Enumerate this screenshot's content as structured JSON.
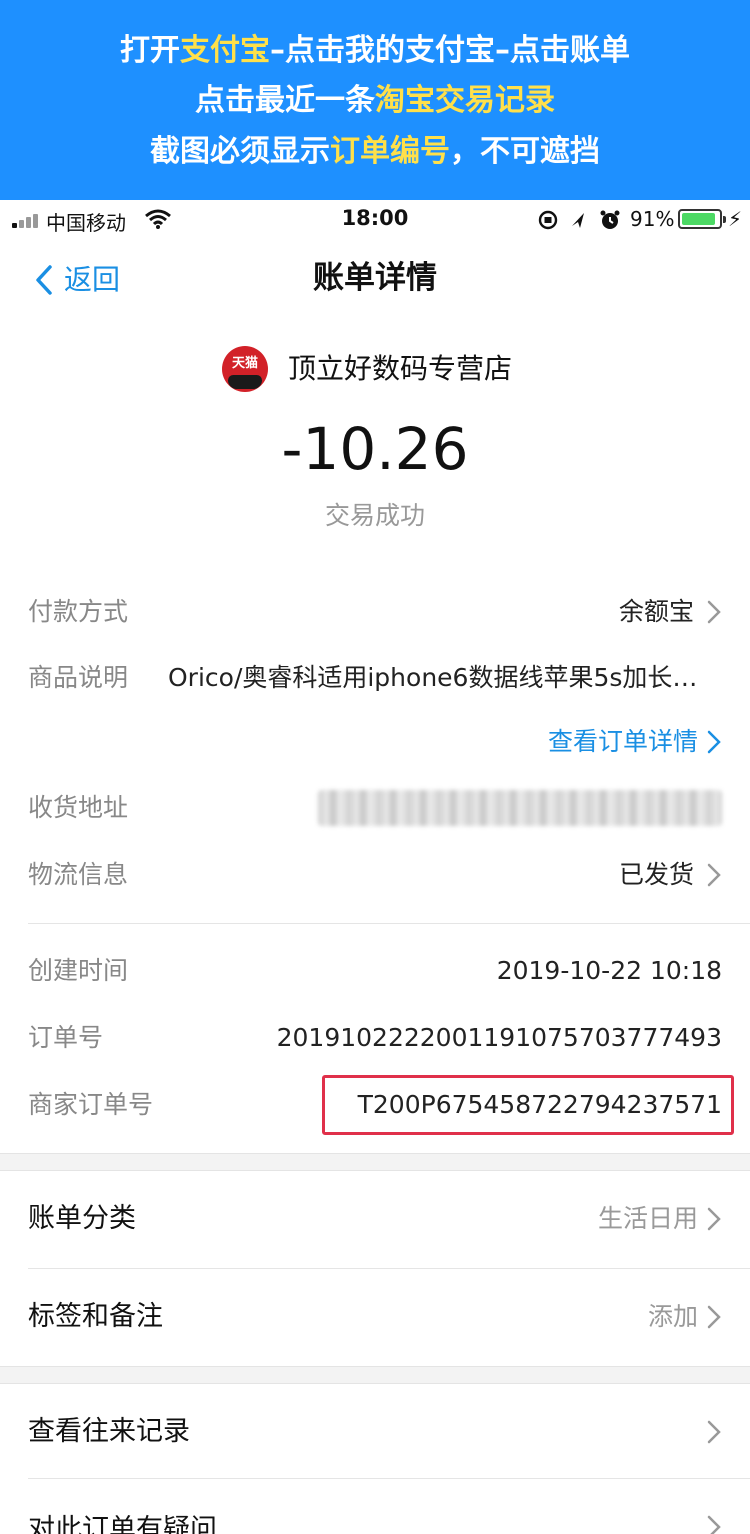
{
  "banner": {
    "line1": {
      "pre": "打开",
      "hl1": "支付宝",
      "mid": "–点击我的支付宝–点击账单"
    },
    "line2": {
      "pre": "点击最近一条",
      "hl1": "淘宝交易记录"
    },
    "line3": {
      "pre": "截图必须显示",
      "hl1": "订单编号",
      "post": "，不可遮挡"
    }
  },
  "status_bar": {
    "carrier": "中国移动",
    "time": "18:00",
    "battery_percent": "91%",
    "battery_level": 0.91,
    "charging_symbol": "⚡"
  },
  "nav": {
    "back_label": "返回",
    "title": "账单详情"
  },
  "merchant": {
    "logo_text": "天猫",
    "name": "顶立好数码专营店"
  },
  "amount": "-10.26",
  "status": "交易成功",
  "details": {
    "payment_method": {
      "label": "付款方式",
      "value": "余额宝"
    },
    "goods": {
      "label": "商品说明",
      "value": "Orico/奥睿科适用iphone6数据线苹果5s加长…"
    },
    "view_order_link": "查看订单详情",
    "address": {
      "label": "收货地址"
    },
    "logistics": {
      "label": "物流信息",
      "value": "已发货"
    },
    "created": {
      "label": "创建时间",
      "value": "2019-10-22 10:18"
    },
    "order_no": {
      "label": "订单号",
      "value": "2019102222001191075703777493"
    },
    "merchant_order_no": {
      "label": "商家订单号",
      "value": "T200P675458722794237571"
    }
  },
  "list1": [
    {
      "label": "账单分类",
      "value": "生活日用"
    },
    {
      "label": "标签和备注",
      "value": "添加"
    }
  ],
  "list2": [
    {
      "label": "查看往来记录"
    },
    {
      "label": "对此订单有疑问"
    }
  ],
  "colors": {
    "banner_bg": "#1E90FF",
    "banner_highlight": "#FFE04A",
    "link_blue": "#1A8FE3",
    "highlight_box": "#E0304A",
    "battery_green": "#4CD964"
  }
}
